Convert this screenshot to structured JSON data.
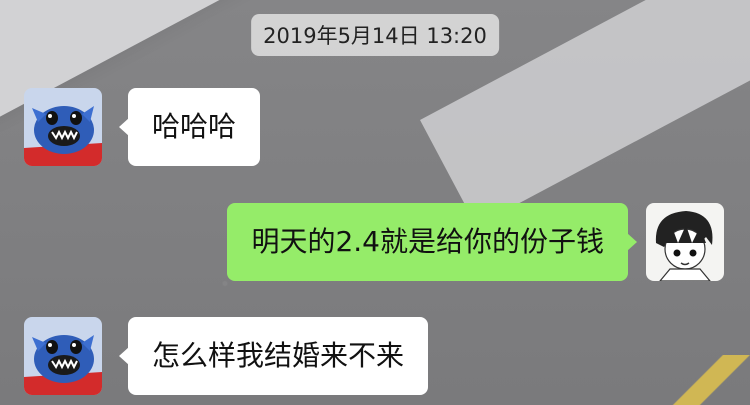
{
  "timestamp": "2019年5月14日 13:20",
  "messages": [
    {
      "side": "left",
      "avatar": "stitch-avatar",
      "text": "哈哈哈"
    },
    {
      "side": "right",
      "avatar": "boy-avatar",
      "text": "明天的2.4就是给你的份子钱"
    },
    {
      "side": "left",
      "avatar": "stitch-avatar",
      "text": "怎么样我结婚来不来"
    }
  ],
  "colors": {
    "incoming_bubble": "#ffffff",
    "outgoing_bubble": "#95ec69",
    "timestamp_bg": "#e1e1e1"
  }
}
